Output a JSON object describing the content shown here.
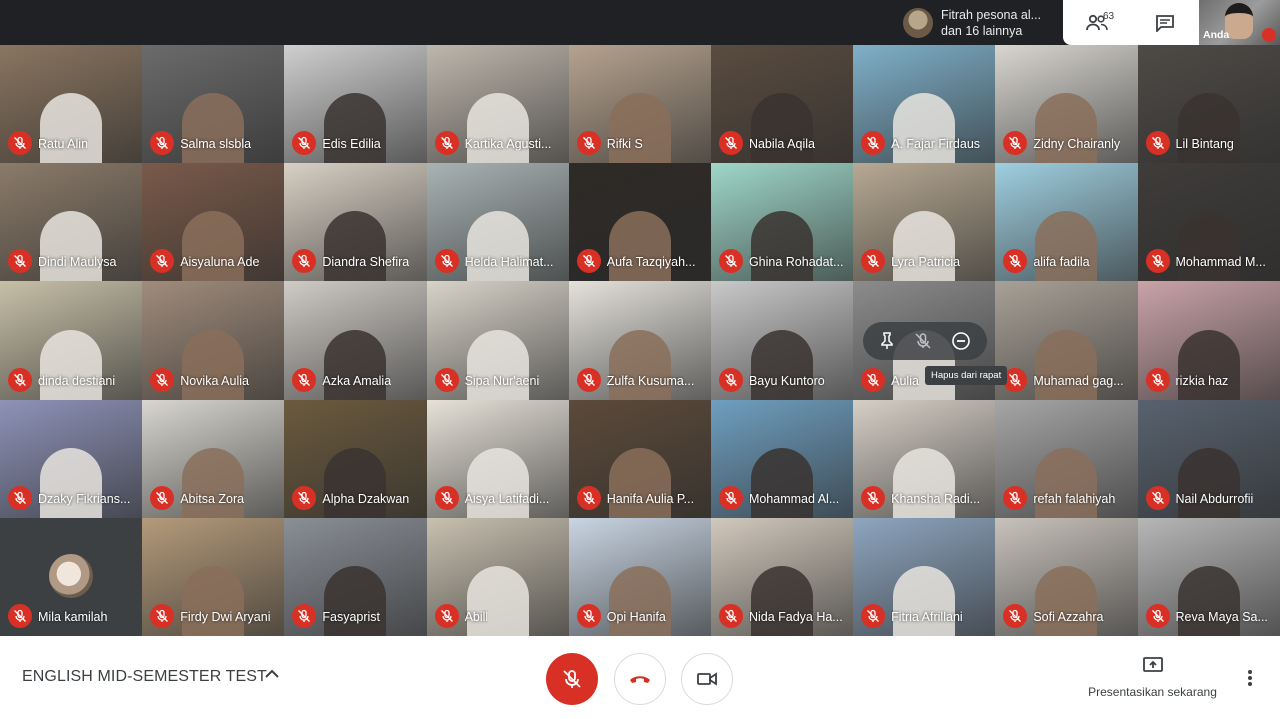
{
  "presenter": {
    "name": "Fitrah pesona al...",
    "others": "dan 16 lainnya"
  },
  "top_actions": {
    "participant_count": "63"
  },
  "self_view": {
    "label": "Anda"
  },
  "participants": [
    {
      "name": "Ratu Alin",
      "bg": "#8a7560"
    },
    {
      "name": "Salma slsbla",
      "bg": "#6b6b6b"
    },
    {
      "name": "Edis Edilia",
      "bg": "#cfcfcf"
    },
    {
      "name": "Kartika Agusti...",
      "bg": "#bfb7ad"
    },
    {
      "name": "Rifki S",
      "bg": "#b6a38f"
    },
    {
      "name": "Nabila Aqila",
      "bg": "#5a4c40"
    },
    {
      "name": "A. Fajar Firdaus",
      "bg": "#7fb0c9"
    },
    {
      "name": "Zidny Chairanly",
      "bg": "#d9d6d0"
    },
    {
      "name": "Lil Bintang",
      "bg": "#4e4a46"
    },
    {
      "name": "Dindi Maulysa",
      "bg": "#8b7b6a"
    },
    {
      "name": "Aisyaluna Ade",
      "bg": "#7a5a4a"
    },
    {
      "name": "Diandra Shefira",
      "bg": "#d8d0c4"
    },
    {
      "name": "Helda Halimat...",
      "bg": "#a9b3b4"
    },
    {
      "name": "Aufa Tazqiyah...",
      "bg": "#2e2a26"
    },
    {
      "name": "Ghina Rohadat...",
      "bg": "#9fd7c9"
    },
    {
      "name": "Lyra Patricia",
      "bg": "#b7a993"
    },
    {
      "name": "alifa fadila",
      "bg": "#9fcfe0"
    },
    {
      "name": "Mohammad M...",
      "bg": "#3f3c3a"
    },
    {
      "name": "dinda destiani",
      "bg": "#c7c0a8"
    },
    {
      "name": "Novika Aulia",
      "bg": "#a08c7c"
    },
    {
      "name": "Azka Amalia",
      "bg": "#cfcbc6"
    },
    {
      "name": "Sipa Nur'aeni",
      "bg": "#d8d3c9"
    },
    {
      "name": "Zulfa Kusuma...",
      "bg": "#e5e2dc"
    },
    {
      "name": "Bayu Kuntoro",
      "bg": "#c9c9c9"
    },
    {
      "name": "Aulia",
      "bg": "#8c8c8c"
    },
    {
      "name": "Muhamad gag...",
      "bg": "#a9a197"
    },
    {
      "name": "rizkia haz",
      "bg": "#c9a3a8"
    },
    {
      "name": "Dzaky Fikrians...",
      "bg": "#8e93b8"
    },
    {
      "name": "Abitsa Zora",
      "bg": "#d8d6cf"
    },
    {
      "name": "Alpha Dzakwan",
      "bg": "#6b5a3e"
    },
    {
      "name": "Aisya Latifadi...",
      "bg": "#e6e1d8"
    },
    {
      "name": "Hanifa Aulia P...",
      "bg": "#5c4a3a"
    },
    {
      "name": "Mohammad Al...",
      "bg": "#6f9fc0"
    },
    {
      "name": "Khansha Radi...",
      "bg": "#d6cfc6"
    },
    {
      "name": "refah falahiyah",
      "bg": "#a6a6a6"
    },
    {
      "name": "Nail Abdurrofii",
      "bg": "#58626f"
    },
    {
      "name": "Mila kamilah",
      "bg": "#3c4043",
      "avatar": true
    },
    {
      "name": "Firdy Dwi Aryani",
      "bg": "#b49a7a"
    },
    {
      "name": "Fasyaprist",
      "bg": "#8a8f96"
    },
    {
      "name": "Abill",
      "bg": "#c8c0b0"
    },
    {
      "name": "Opi Hanifa",
      "bg": "#c9d5e3"
    },
    {
      "name": "Nida Fadya Ha...",
      "bg": "#d2c9bd"
    },
    {
      "name": "Fitria Afrillani",
      "bg": "#8ea6c0"
    },
    {
      "name": "Sofi Azzahra",
      "bg": "#c8c2bb"
    },
    {
      "name": "Reva Maya Sa...",
      "bg": "#b7b7b7"
    }
  ],
  "hover_menu": {
    "tooltip": "Hapus dari rapat"
  },
  "bottom": {
    "meeting_title": "ENGLISH MID-SEMESTER TEST",
    "present_label": "Presentasikan sekarang"
  },
  "colors": {
    "mute_red": "#d93025",
    "bar_bg": "#202124",
    "end_call_red": "#d93025"
  }
}
